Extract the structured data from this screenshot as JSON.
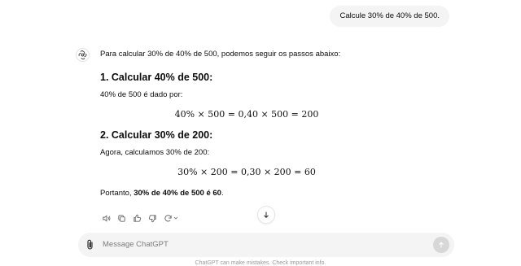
{
  "user_message": "Calcule 30% de 40% de 500.",
  "assistant": {
    "icon": "openai-logo-icon",
    "intro": "Para calcular 30% de 40% de 500, podemos seguir os passos abaixo:",
    "step1": {
      "heading": "1. Calcular 40% de 500:",
      "text": "40% de 500 é dado por:",
      "equation": "40% × 500 = 0,40 × 500 = 200"
    },
    "step2": {
      "heading": "2. Calcular 30% de 200:",
      "text": "Agora, calculamos 30% de 200:",
      "equation": "30% × 200 = 0,30 × 200 = 60"
    },
    "conclusion": {
      "prefix": "Portanto, ",
      "bold": "30% de 40% de 500 é 60",
      "suffix": "."
    }
  },
  "actions": [
    "speaker-icon",
    "copy-icon",
    "thumbs-up-icon",
    "thumbs-down-icon",
    "regenerate-icon",
    "chevron-down-icon"
  ],
  "scroll_down_icon": "arrow-down-icon",
  "composer": {
    "placeholder": "Message ChatGPT",
    "attach_icon": "paperclip-icon",
    "send_icon": "arrow-up-icon"
  },
  "footer": "ChatGPT can make mistakes. Check important info."
}
